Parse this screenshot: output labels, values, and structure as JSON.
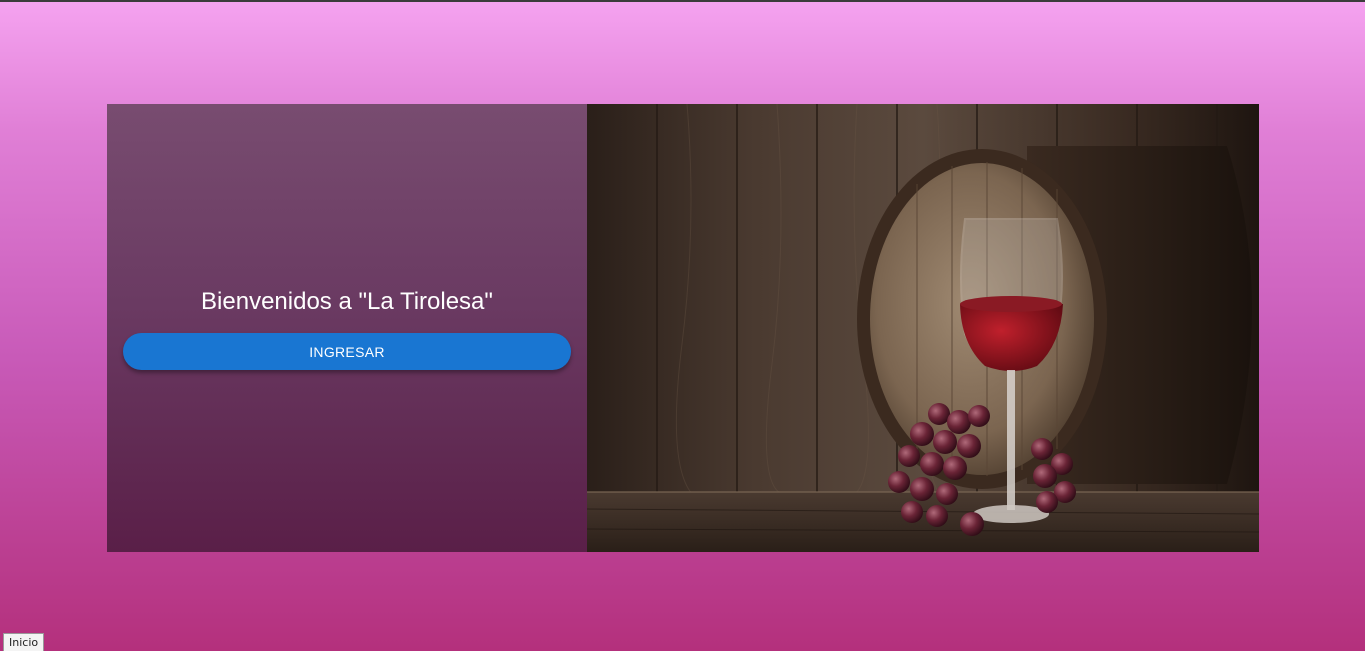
{
  "welcome": {
    "title": "Bienvenidos a \"La Tirolesa\"",
    "button_label": "INGRESAR"
  },
  "hero_image": {
    "icon": "wine-barrel-grapes-image"
  },
  "status_bar": {
    "text": "Inicio"
  },
  "colors": {
    "button": "#1976d2",
    "panel_top": "#784c70",
    "panel_bottom": "#5a1f48",
    "page_top": "#f5a3f0",
    "page_bottom": "#b4307c"
  }
}
